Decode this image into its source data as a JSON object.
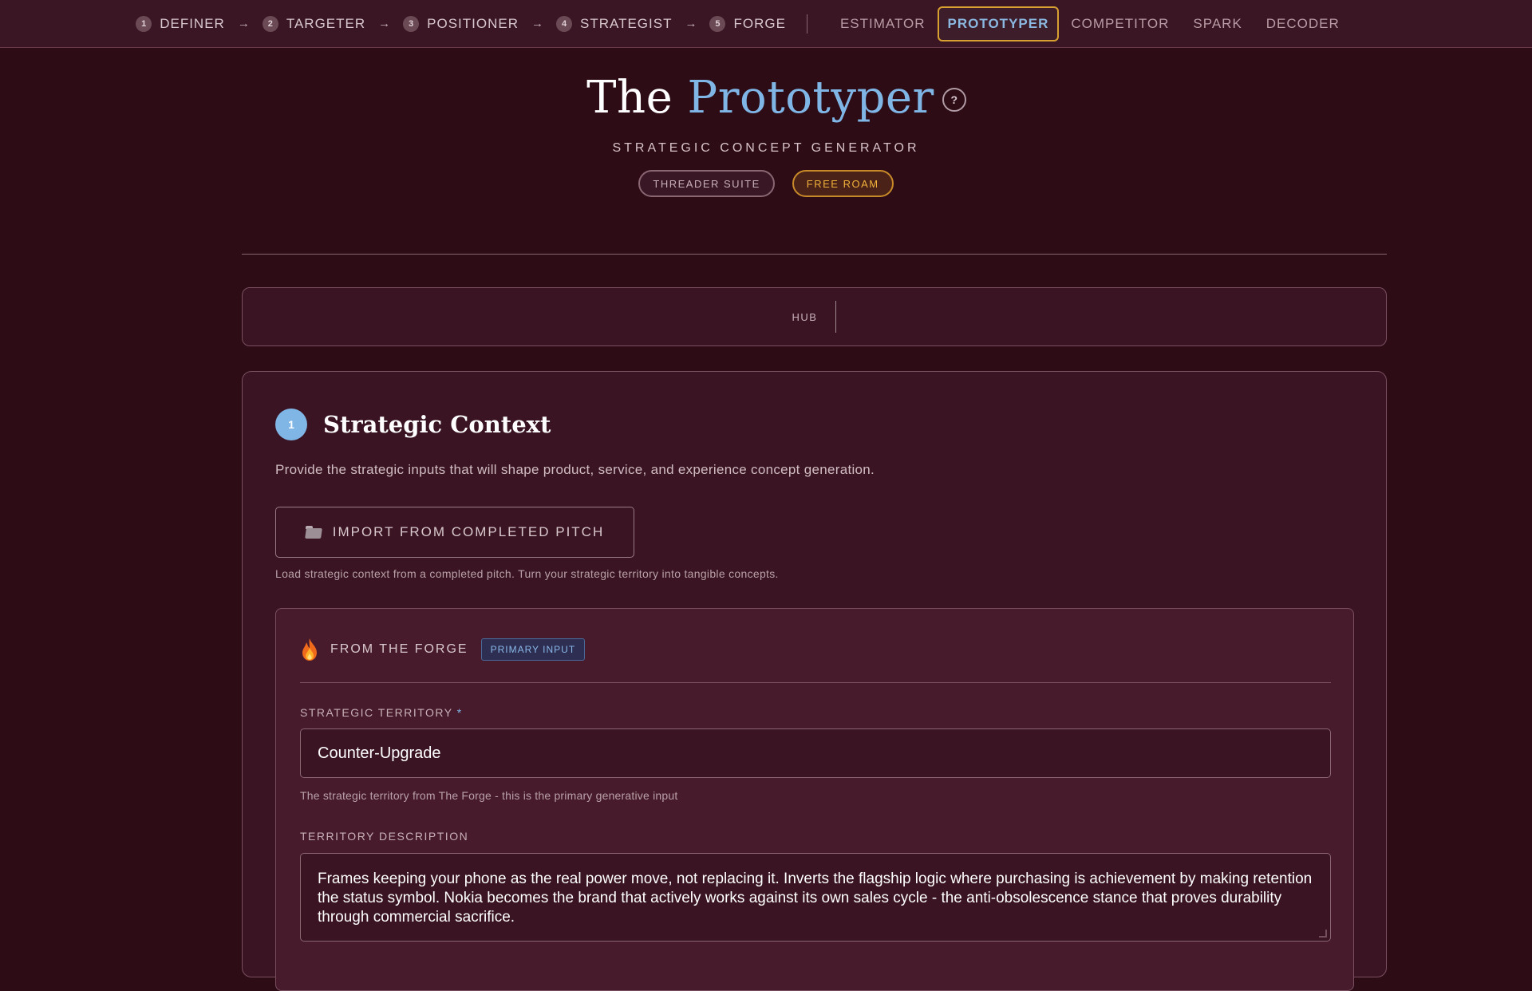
{
  "nav": {
    "steps": [
      {
        "num": "1",
        "label": "DEFINER"
      },
      {
        "num": "2",
        "label": "TARGETER"
      },
      {
        "num": "3",
        "label": "POSITIONER"
      },
      {
        "num": "4",
        "label": "STRATEGIST"
      },
      {
        "num": "5",
        "label": "FORGE"
      }
    ],
    "arrow": "→",
    "tools": [
      "ESTIMATOR",
      "PROTOTYPER",
      "COMPETITOR",
      "SPARK",
      "DECODER"
    ],
    "active_tool": "PROTOTYPER"
  },
  "hero": {
    "title_plain": "The",
    "title_accent": "Prototyper",
    "help_icon": "?",
    "subtitle": "STRATEGIC CONCEPT GENERATOR",
    "pill_suite": "THREADER SUITE",
    "pill_roam": "FREE ROAM"
  },
  "hub": {
    "label": "HUB"
  },
  "section": {
    "number": "1",
    "title": "Strategic Context",
    "description": "Provide the strategic inputs that will shape product, service, and experience concept generation.",
    "import_button": "IMPORT FROM COMPLETED PITCH",
    "import_help": "Load strategic context from a completed pitch. Turn your strategic territory into tangible concepts."
  },
  "forge": {
    "label": "FROM THE FORGE",
    "badge": "PRIMARY INPUT",
    "territory_label": "STRATEGIC TERRITORY",
    "required_mark": "*",
    "territory_value": "Counter-Upgrade",
    "territory_help": "The strategic territory from The Forge - this is the primary generative input",
    "description_label": "TERRITORY DESCRIPTION",
    "description_value": "Frames keeping your phone as the real power move, not replacing it. Inverts the flagship logic where purchasing is achievement by making retention the status symbol. Nokia becomes the brand that actively works against its own sales cycle - the anti-obsolescence stance that proves durability through commercial sacrifice."
  },
  "colors": {
    "background": "#2d0c16",
    "accent_blue": "#7fb6e6",
    "accent_gold": "#d8a030"
  }
}
